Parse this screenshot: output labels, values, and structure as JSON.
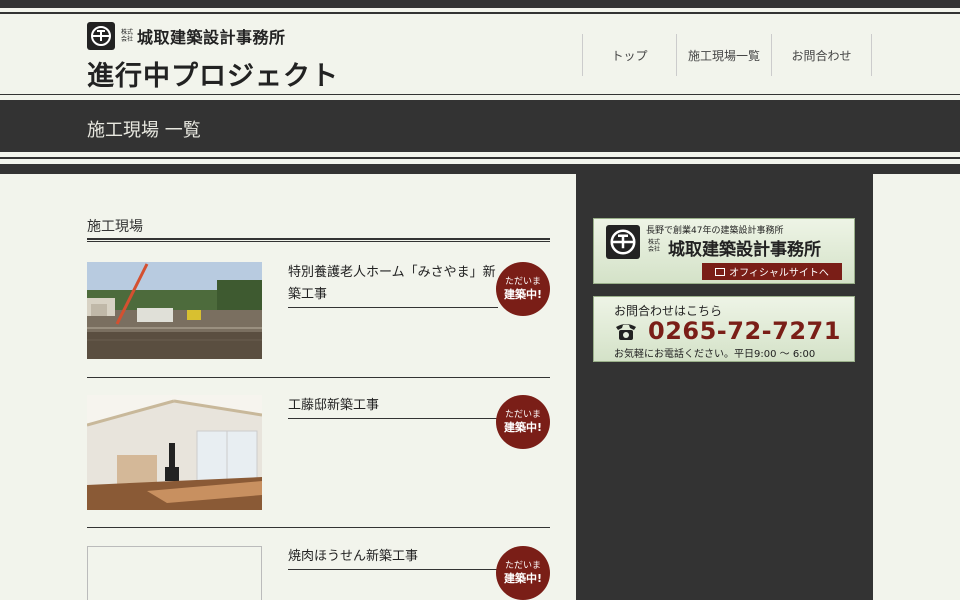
{
  "header": {
    "kabu_line1": "株式",
    "kabu_line2": "会社",
    "company_name": "城取建築設計事務所",
    "site_title": "進行中プロジェクト",
    "logo_icon": "company-logo-icon"
  },
  "nav": {
    "items": [
      {
        "label": "トップ"
      },
      {
        "label": "施工現場一覧"
      },
      {
        "label": "お問合わせ"
      }
    ]
  },
  "page": {
    "band_title": "施工現場 一覧",
    "section_title": "施工現場"
  },
  "badge": {
    "line1": "ただいま",
    "line2": "建築中!"
  },
  "items": [
    {
      "title": "特別養護老人ホーム「みさやま」新築工事"
    },
    {
      "title": "工藤邸新築工事"
    },
    {
      "title": "焼肉ほうせん新築工事"
    }
  ],
  "sidebar": {
    "banner1": {
      "sub": "長野で創業47年の建築設計事務所",
      "kabu_line1": "株式",
      "kabu_line2": "会社",
      "name": "城取建築設計事務所",
      "button": "オフィシャルサイトへ"
    },
    "banner2": {
      "head": "お問合わせはこちら",
      "phone": "0265-72-7271",
      "note": "お気軽にお電話ください。平日9:00 〜 6:00"
    }
  },
  "colors": {
    "dark": "#333333",
    "accent": "#7a1e17",
    "background": "#f2f4ec"
  }
}
